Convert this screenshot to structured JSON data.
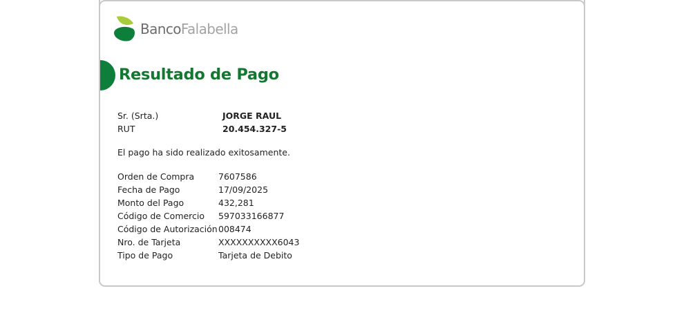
{
  "brand": {
    "name_part1": "Banco",
    "name_part2": "Falabella",
    "colors": {
      "green_dark": "#0d7f3a",
      "green_light": "#a9cd3a",
      "title_green": "#12772f",
      "text_gray_dark": "#6d6d6d",
      "text_gray_light": "#a3a3a3"
    }
  },
  "page": {
    "title": "Resultado de Pago",
    "message": "El pago ha sido realizado exitosamente."
  },
  "client": {
    "name_label": "Sr. (Srta.)",
    "name_value": "JORGE RAUL",
    "rut_label": "RUT",
    "rut_value": "20.454.327-5"
  },
  "details": [
    {
      "label": "Orden de Compra",
      "value": "7607586"
    },
    {
      "label": "Fecha de Pago",
      "value": "17/09/2025"
    },
    {
      "label": "Monto del Pago",
      "value": "432,281"
    },
    {
      "label": "Código de Comercio",
      "value": "597033166877"
    },
    {
      "label": "Código de Autorización",
      "value": "008474"
    },
    {
      "label": "Nro. de Tarjeta",
      "value": "XXXXXXXXXX6043"
    },
    {
      "label": "Tipo de Pago",
      "value": "Tarjeta de Debito"
    }
  ]
}
